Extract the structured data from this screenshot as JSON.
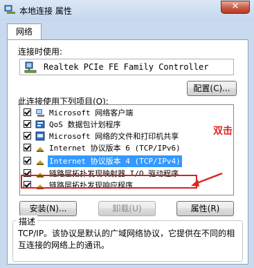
{
  "window": {
    "title": "本地连接 属性",
    "close_glyph": "✕"
  },
  "tabs": [
    {
      "label": "网络"
    }
  ],
  "connect_using": {
    "label": "连接时使用:",
    "adapter": "Realtek PCIe FE Family Controller",
    "configure_button": "配置(C)..."
  },
  "items_section": {
    "label": "此连接使用下列项目(O):",
    "items": [
      {
        "label": "Microsoft 网络客户端",
        "checked": true,
        "icon": "network-client-icon"
      },
      {
        "label": "QoS 数据包计划程序",
        "checked": true,
        "icon": "qos-scheduler-icon"
      },
      {
        "label": "Microsoft 网络的文件和打印机共享",
        "checked": true,
        "icon": "file-printer-sharing-icon"
      },
      {
        "label": "Internet 协议版本 6 (TCP/IPv6)",
        "checked": true,
        "icon": "protocol-icon"
      },
      {
        "label": "Internet 协议版本 4 (TCP/IPv4)",
        "checked": true,
        "icon": "protocol-icon",
        "selected": true
      },
      {
        "label": "链路层拓扑发现映射器 I/O 驱动程序",
        "checked": true,
        "icon": "protocol-icon"
      },
      {
        "label": "链路层拓扑发现响应程序",
        "checked": true,
        "icon": "protocol-icon"
      }
    ]
  },
  "annotation": {
    "text": "双击",
    "color": "#e0251f"
  },
  "buttons": {
    "install": "安装(N)...",
    "uninstall": "卸载(U)",
    "properties": "属性(R)"
  },
  "description": {
    "title": "描述",
    "text": "TCP/IP。该协议是默认的广域网络协议，它提供在不同的相互连接的网络上的通讯。"
  },
  "colors": {
    "selection": "#3399ff",
    "highlight_box": "#d4221b"
  }
}
